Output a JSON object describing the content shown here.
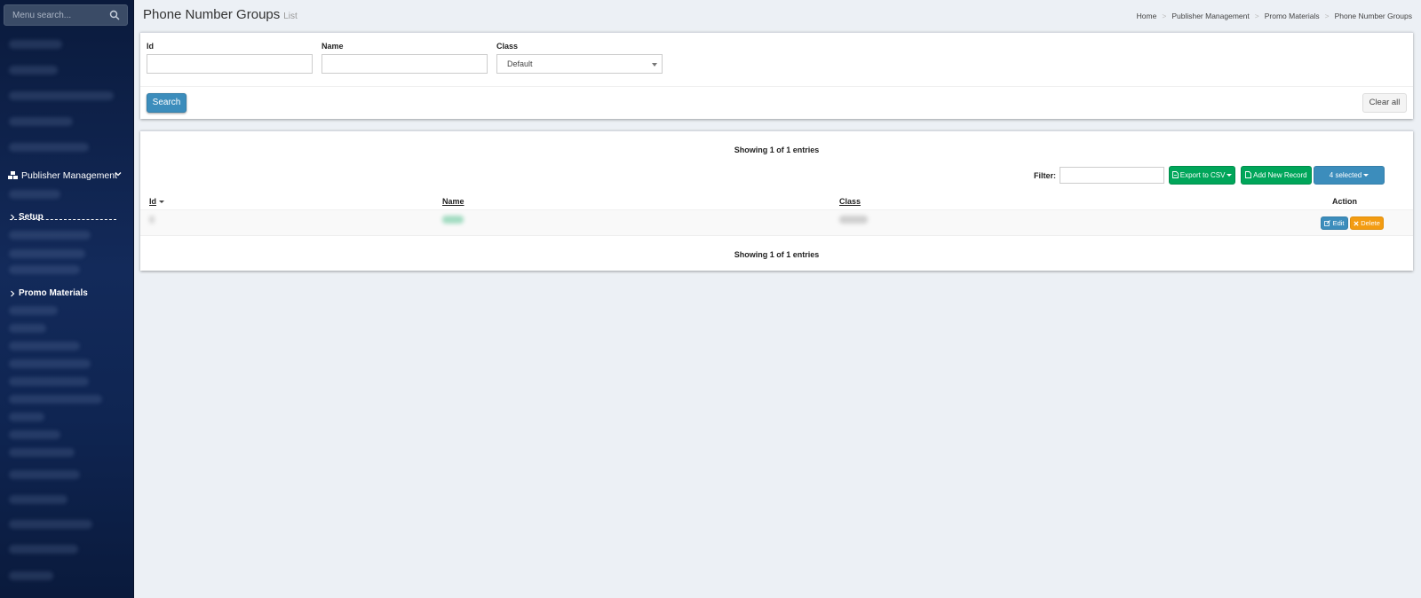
{
  "sidebar": {
    "search_placeholder": "Menu search...",
    "publisher_label": "Publisher Management",
    "setup_label": "Setup",
    "promo_label": "Promo Materials"
  },
  "header": {
    "title": "Phone Number Groups",
    "subtitle": "List",
    "breadcrumb": [
      "Home",
      "Publisher Management",
      "Promo Materials",
      "Phone Number Groups"
    ]
  },
  "filters": {
    "id_label": "Id",
    "id_value": "",
    "name_label": "Name",
    "name_value": "",
    "class_label": "Class",
    "class_value": "Default",
    "search_label": "Search",
    "clear_label": "Clear all"
  },
  "list": {
    "showing_text": "Showing 1 of 1 entries",
    "filter_label": "Filter:",
    "filter_value": "",
    "export_label": "Export to CSV",
    "add_label": "Add New Record",
    "selected_label": "4 selected",
    "columns": {
      "id": "Id",
      "name": "Name",
      "class": "Class",
      "action": "Action"
    },
    "row_actions": {
      "edit": "Edit",
      "delete": "Delete"
    }
  },
  "colors": {
    "sidebar_bg": "#0a1a3c",
    "primary": "#3c8dbc",
    "success": "#00a65a",
    "warning": "#f39c12",
    "page_bg": "#ecf0f5"
  },
  "icons": [
    "search-icon",
    "cubes-icon",
    "chevron-down-icon",
    "chevron-right-icon",
    "file-icon",
    "edit-icon",
    "close-icon",
    "caret-down-icon"
  ]
}
